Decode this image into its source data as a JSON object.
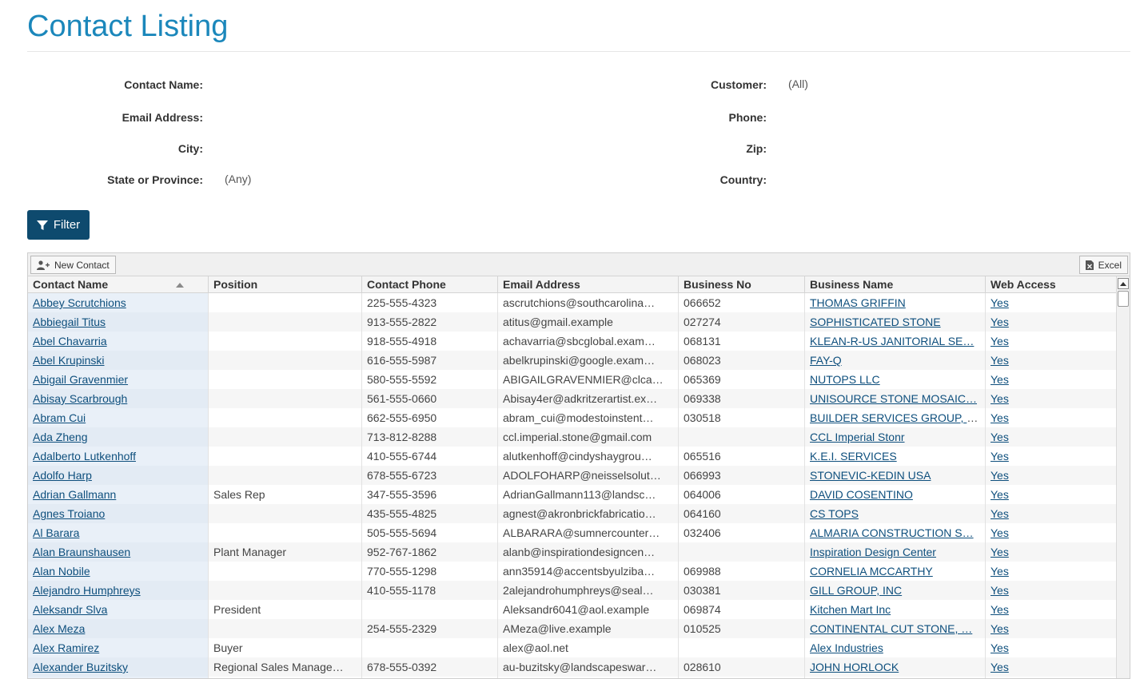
{
  "page": {
    "title": "Contact Listing"
  },
  "filters": {
    "contact_name_label": "Contact Name:",
    "email_label": "Email Address:",
    "city_label": "City:",
    "state_label": "State or Province:",
    "state_value": "(Any)",
    "customer_label": "Customer:",
    "customer_value": "(All)",
    "phone_label": "Phone:",
    "zip_label": "Zip:",
    "country_label": "Country:",
    "filter_button": "Filter"
  },
  "toolbar": {
    "new_contact": "New Contact",
    "excel": "Excel"
  },
  "columns": [
    "Contact Name",
    "Position",
    "Contact Phone",
    "Email Address",
    "Business No",
    "Business Name",
    "Web Access"
  ],
  "rows": [
    {
      "name": "Abbey Scrutchions",
      "position": "",
      "phone": "225-555-4323",
      "email": "ascrutchions@southcarolina…",
      "bizno": "066652",
      "bizname": "THOMAS GRIFFIN",
      "web": "Yes"
    },
    {
      "name": "Abbiegail Titus",
      "position": "",
      "phone": "913-555-2822",
      "email": "atitus@gmail.example",
      "bizno": "027274",
      "bizname": "SOPHISTICATED STONE",
      "web": "Yes"
    },
    {
      "name": "Abel Chavarria",
      "position": "",
      "phone": "918-555-4918",
      "email": "achavarria@sbcglobal.exam…",
      "bizno": "068131",
      "bizname": "KLEAN-R-US JANITORIAL SE…",
      "web": "Yes"
    },
    {
      "name": "Abel Krupinski",
      "position": "",
      "phone": "616-555-5987",
      "email": "abelkrupinski@google.exam…",
      "bizno": "068023",
      "bizname": "FAY-Q",
      "web": "Yes"
    },
    {
      "name": "Abigail Gravenmier",
      "position": "",
      "phone": "580-555-5592",
      "email": "ABIGAILGRAVENMIER@clca…",
      "bizno": "065369",
      "bizname": "NUTOPS LLC",
      "web": "Yes"
    },
    {
      "name": "Abisay Scarbrough",
      "position": "",
      "phone": "561-555-0660",
      "email": "Abisay4er@adkritzerartist.ex…",
      "bizno": "069338",
      "bizname": "UNISOURCE STONE MOSAIC…",
      "web": "Yes"
    },
    {
      "name": "Abram Cui",
      "position": "",
      "phone": "662-555-6950",
      "email": "abram_cui@modestoinstent…",
      "bizno": "030518",
      "bizname": "BUILDER SERVICES GROUP, I…",
      "web": "Yes"
    },
    {
      "name": "Ada Zheng",
      "position": "",
      "phone": "713-812-8288",
      "email": "ccl.imperial.stone@gmail.com",
      "bizno": "",
      "bizname": "CCL Imperial Stonr",
      "web": "Yes"
    },
    {
      "name": "Adalberto Lutkenhoff",
      "position": "",
      "phone": "410-555-6744",
      "email": "alutkenhoff@cindyshaygrou…",
      "bizno": "065516",
      "bizname": "K.E.I. SERVICES",
      "web": "Yes"
    },
    {
      "name": "Adolfo Harp",
      "position": "",
      "phone": "678-555-6723",
      "email": "ADOLFOHARP@neisselsolut…",
      "bizno": "066993",
      "bizname": "STONEVIC-KEDIN USA",
      "web": "Yes"
    },
    {
      "name": "Adrian Gallmann",
      "position": "Sales Rep",
      "phone": "347-555-3596",
      "email": "AdrianGallmann113@landsc…",
      "bizno": "064006",
      "bizname": "DAVID COSENTINO",
      "web": "Yes"
    },
    {
      "name": "Agnes Troiano",
      "position": "",
      "phone": "435-555-4825",
      "email": "agnest@akronbrickfabricatio…",
      "bizno": "064160",
      "bizname": "CS TOPS",
      "web": "Yes"
    },
    {
      "name": "Al Barara",
      "position": "",
      "phone": "505-555-5694",
      "email": "ALBARARA@sumnercounter…",
      "bizno": "032406",
      "bizname": "ALMARIA CONSTRUCTION S…",
      "web": "Yes"
    },
    {
      "name": "Alan Braunshausen",
      "position": "Plant Manager",
      "phone": "952-767-1862",
      "email": "alanb@inspirationdesigncen…",
      "bizno": "",
      "bizname": "Inspiration Design Center",
      "web": "Yes"
    },
    {
      "name": "Alan Nobile",
      "position": "",
      "phone": "770-555-1298",
      "email": "ann35914@accentsbyulziba…",
      "bizno": "069988",
      "bizname": "CORNELIA MCCARTHY",
      "web": "Yes"
    },
    {
      "name": "Alejandro Humphreys",
      "position": "",
      "phone": "410-555-1178",
      "email": "2alejandrohumphreys@seal…",
      "bizno": "030381",
      "bizname": "GILL GROUP, INC",
      "web": "Yes"
    },
    {
      "name": "Aleksandr Slva",
      "position": "President",
      "phone": "",
      "email": "Aleksandr6041@aol.example",
      "bizno": "069874",
      "bizname": "Kitchen Mart Inc",
      "web": "Yes"
    },
    {
      "name": "Alex Meza",
      "position": "",
      "phone": "254-555-2329",
      "email": "AMeza@live.example",
      "bizno": "010525",
      "bizname": "CONTINENTAL CUT STONE, …",
      "web": "Yes"
    },
    {
      "name": "Alex Ramirez",
      "position": "Buyer",
      "phone": "",
      "email": "alex@aol.net",
      "bizno": "",
      "bizname": "Alex Industries",
      "web": "Yes"
    },
    {
      "name": "Alexander Buzitsky",
      "position": "Regional Sales Manage…",
      "phone": "678-555-0392",
      "email": "au-buzitsky@landscapeswar…",
      "bizno": "028610",
      "bizname": "JOHN HORLOCK",
      "web": "Yes"
    },
    {
      "name": "",
      "position": "",
      "phone": "",
      "email": "",
      "bizno": "",
      "bizname": "",
      "web": ""
    }
  ]
}
